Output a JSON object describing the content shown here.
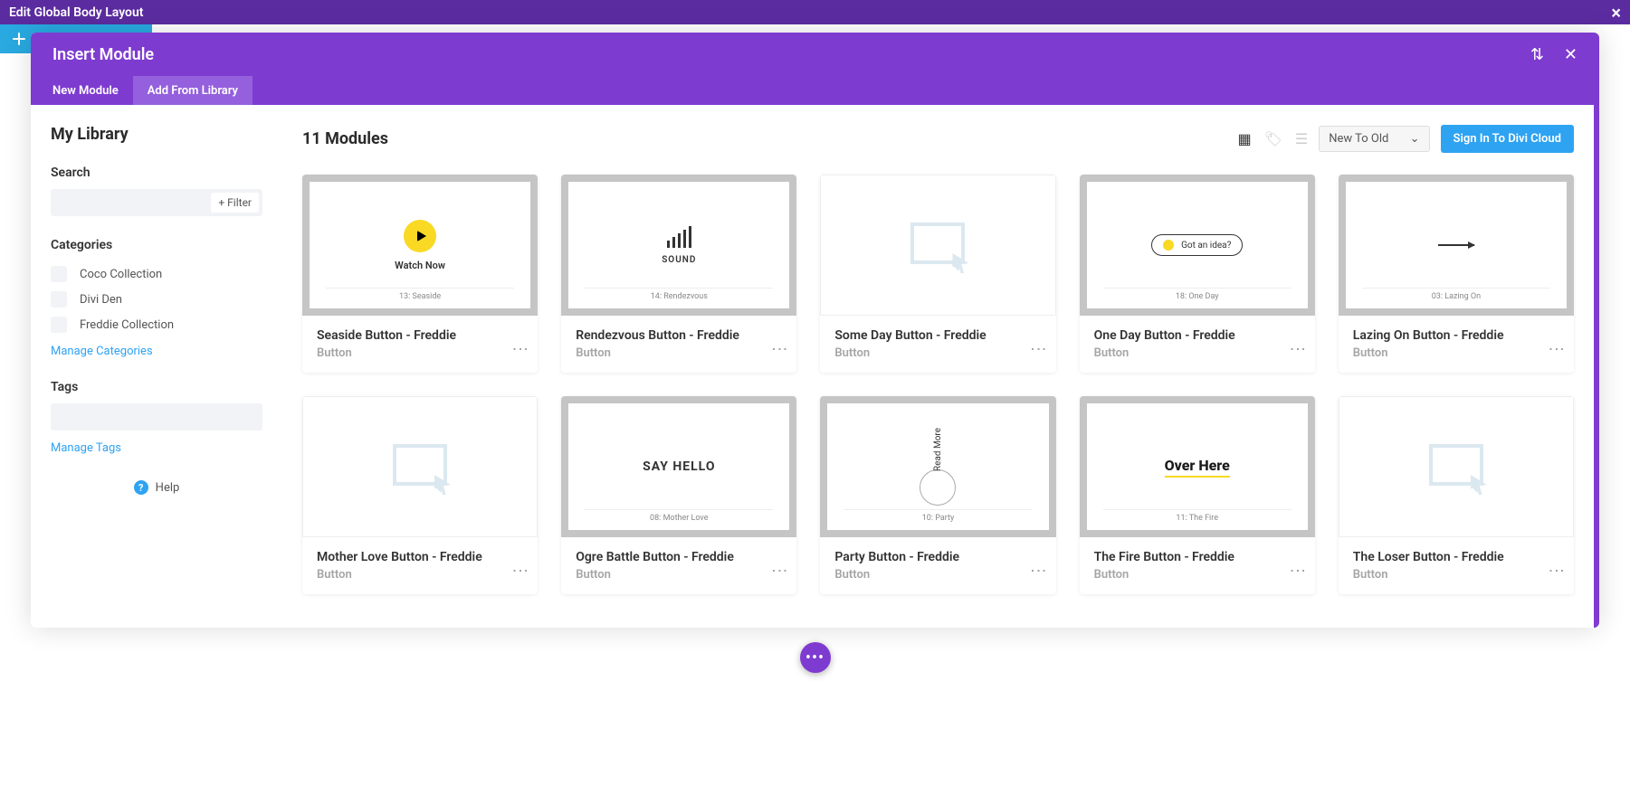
{
  "topBar": {
    "title": "Edit Global Body Layout"
  },
  "modal": {
    "title": "Insert Module",
    "tabs": {
      "new": "New Module",
      "library": "Add From Library"
    }
  },
  "sidebar": {
    "title": "My Library",
    "searchLabel": "Search",
    "filterBtn": "+ Filter",
    "categoriesLabel": "Categories",
    "categories": [
      {
        "name": "Coco Collection"
      },
      {
        "name": "Divi Den"
      },
      {
        "name": "Freddie Collection"
      }
    ],
    "manageCategories": "Manage Categories",
    "tagsLabel": "Tags",
    "manageTags": "Manage Tags",
    "help": "Help"
  },
  "content": {
    "countLabel": "11 Modules",
    "sort": "New To Old",
    "signIn": "Sign In To Divi Cloud"
  },
  "modules": [
    {
      "title": "Seaside Button - Freddie",
      "type": "Button",
      "caption": "13: Seaside",
      "preview": "watch",
      "previewText": "Watch Now"
    },
    {
      "title": "Rendezvous Button - Freddie",
      "type": "Button",
      "caption": "14: Rendezvous",
      "preview": "sound",
      "previewText": "SOUND"
    },
    {
      "title": "Some Day Button - Freddie",
      "type": "Button",
      "caption": "",
      "preview": "placeholder",
      "previewText": ""
    },
    {
      "title": "One Day Button - Freddie",
      "type": "Button",
      "caption": "18: One Day",
      "preview": "pill",
      "previewText": "Got an idea?"
    },
    {
      "title": "Lazing On Button - Freddie",
      "type": "Button",
      "caption": "03: Lazing On",
      "preview": "arrow",
      "previewText": ""
    },
    {
      "title": "Mother Love Button - Freddie",
      "type": "Button",
      "caption": "",
      "preview": "placeholder",
      "previewText": ""
    },
    {
      "title": "Ogre Battle Button - Freddie",
      "type": "Button",
      "caption": "08: Mother Love",
      "preview": "sayhello",
      "previewText": "SAY HELLO"
    },
    {
      "title": "Party Button - Freddie",
      "type": "Button",
      "caption": "10: Party",
      "preview": "readmore",
      "previewText": "Read More"
    },
    {
      "title": "The Fire Button - Freddie",
      "type": "Button",
      "caption": "11: The Fire",
      "preview": "overhere",
      "previewText": "Over Here"
    },
    {
      "title": "The Loser Button - Freddie",
      "type": "Button",
      "caption": "",
      "preview": "placeholder",
      "previewText": ""
    }
  ]
}
